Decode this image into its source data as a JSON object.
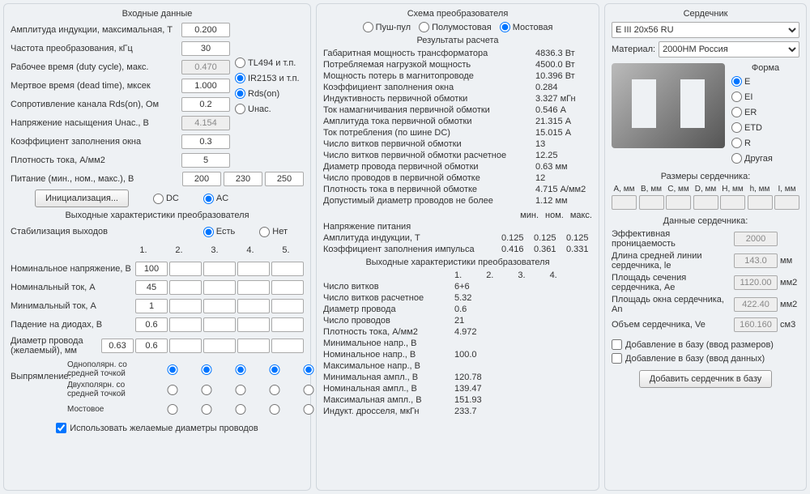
{
  "col1": {
    "title": "Входные данные",
    "inputs": [
      {
        "label": "Амплитуда индукции, максимальная, Т",
        "val": "0.200"
      },
      {
        "label": "Частота преобразования, кГц",
        "val": "30"
      },
      {
        "label": "Рабочее время (duty cycle), макс.",
        "val": "0.470",
        "dis": true
      },
      {
        "label": "Мертвое время (dead time), мксек",
        "val": "1.000"
      },
      {
        "label": "Сопротивление канала Rds(on), Ом",
        "val": "0.2"
      },
      {
        "label": "Напряжение насыщения Uнас., В",
        "val": "4.154",
        "dis": true
      },
      {
        "label": "Коэффициент заполнения окна",
        "val": "0.3"
      },
      {
        "label": "Плотность тока, А/мм2",
        "val": "5"
      }
    ],
    "side_radios": [
      "TL494 и т.п.",
      "IR2153 и т.п.",
      "Rds(on)",
      "Uнас."
    ],
    "side_sel": 1,
    "supply_label": "Питание (мин., ном., макс.), В",
    "supply": [
      "200",
      "230",
      "250"
    ],
    "init_btn": "Инициализация...",
    "dcac": [
      "DC",
      "AC"
    ],
    "dcac_sel": 1,
    "out_title": "Выходные характеристики преобразователя",
    "stab_label": "Стабилизация выходов",
    "stab": [
      "Есть",
      "Нет"
    ],
    "stab_sel": 0,
    "col_nums": [
      "1.",
      "2.",
      "3.",
      "4.",
      "5."
    ],
    "out_rows": [
      {
        "label": "Номинальное напряжение, В",
        "vals": [
          "100",
          "",
          "",
          "",
          ""
        ]
      },
      {
        "label": "Номинальный ток, А",
        "vals": [
          "45",
          "",
          "",
          "",
          ""
        ]
      },
      {
        "label": "Минимальный ток, А",
        "vals": [
          "1",
          "",
          "",
          "",
          ""
        ]
      },
      {
        "label": "Падение на диодах, В",
        "vals": [
          "0.6",
          "",
          "",
          "",
          ""
        ]
      }
    ],
    "wire_label": "Диаметр провода (желаемый), мм",
    "wire": [
      "0.63",
      "0.6",
      "",
      "",
      "",
      ""
    ],
    "rect_label": "Выпрямление:",
    "rect_opts": [
      "Однополярн. со средней точкой",
      "Двухполярн. со средней точкой",
      "Мостовое"
    ],
    "use_wire": "Использовать желаемые диаметры проводов"
  },
  "col2": {
    "title": "Схема преобразователя",
    "scheme": [
      "Пуш-пул",
      "Полумостовая",
      "Мостовая"
    ],
    "scheme_sel": 2,
    "res_title": "Результаты расчета",
    "results": [
      {
        "l": "Габаритная мощность трансформатора",
        "v": "4836.3 Вт"
      },
      {
        "l": "Потребляемая нагрузкой мощность",
        "v": "4500.0 Вт"
      },
      {
        "l": "Мощность потерь в магнитопроводе",
        "v": "10.396 Вт"
      },
      {
        "l": "Коэффициент заполнения окна",
        "v": "0.284"
      },
      {
        "l": "Индуктивность первичной обмотки",
        "v": "3.327 мГн"
      },
      {
        "l": "Ток намагничивания первичной обмотки",
        "v": "0.546 А"
      },
      {
        "l": "Амплитуда тока первичной обмотки",
        "v": "21.315 А"
      },
      {
        "l": "Ток потребления (по шине DC)",
        "v": "15.015 А"
      },
      {
        "l": "Число витков первичной обмотки",
        "v": "13"
      },
      {
        "l": "Число витков первичной обмотки расчетное",
        "v": "12.25"
      },
      {
        "l": "Диаметр провода первичной обмотки",
        "v": "0.63 мм"
      },
      {
        "l": "Число проводов в первичной обмотке",
        "v": "12"
      },
      {
        "l": "Плотность тока в первичной обмотке",
        "v": "4.715 А/мм2"
      },
      {
        "l": "Допустимый диаметр проводов не более",
        "v": "1.12 мм"
      }
    ],
    "mnm_hdr": [
      "мин.",
      "ном.",
      "макс."
    ],
    "mnm": [
      {
        "l": "Напряжение питания",
        "v": [
          "",
          "",
          ""
        ]
      },
      {
        "l": "Амплитуда индукции, Т",
        "v": [
          "0.125",
          "0.125",
          "0.125"
        ]
      },
      {
        "l": "Коэффициент заполнения импульса",
        "v": [
          "0.416",
          "0.361",
          "0.331"
        ]
      }
    ],
    "out2_title": "Выходные характеристики преобразователя",
    "out2_cols": [
      "1.",
      "2.",
      "3.",
      "4."
    ],
    "out2": [
      {
        "l": "Число витков",
        "v": "6+6"
      },
      {
        "l": "Число витков расчетное",
        "v": "5.32"
      },
      {
        "l": "Диаметр провода",
        "v": "0.6"
      },
      {
        "l": "Число проводов",
        "v": "21"
      },
      {
        "l": "Плотность тока, А/мм2",
        "v": "4.972"
      },
      {
        "l": "Минимальное напр., В",
        "v": ""
      },
      {
        "l": "Номинальное напр., В",
        "v": "100.0"
      },
      {
        "l": "Максимальное напр., В",
        "v": ""
      },
      {
        "l": "Минимальная ампл., В",
        "v": "120.78"
      },
      {
        "l": "Номинальная ампл., В",
        "v": "139.47"
      },
      {
        "l": "Максимальная ампл., В",
        "v": "151.93"
      },
      {
        "l": "Индукт. дросселя, мкГн",
        "v": "233.7"
      }
    ]
  },
  "col3": {
    "title": "Сердечник",
    "core_sel": "E III 20x56 RU",
    "mat_label": "Материал:",
    "mat_sel": "2000НМ Россия",
    "shape_title": "Форма",
    "shapes": [
      "E",
      "EI",
      "ER",
      "ETD",
      "R",
      "Другая"
    ],
    "shape_sel": 0,
    "size_title": "Размеры сердечника:",
    "size_hdr": [
      "A, мм",
      "B, мм",
      "C, мм",
      "D, мм",
      "H, мм",
      "h, мм",
      "I, мм"
    ],
    "data_title": "Данные сердечника:",
    "data": [
      {
        "l": "Эффективная проницаемость",
        "v": "2000",
        "u": ""
      },
      {
        "l": "Длина средней линии сердечника, le",
        "v": "143.0",
        "u": "мм"
      },
      {
        "l": "Площадь сечения сердечника, Ае",
        "v": "1120.00",
        "u": "мм2"
      },
      {
        "l": "Площадь окна сердечника, An",
        "v": "422.40",
        "u": "мм2"
      },
      {
        "l": "Объем сердечника, Ve",
        "v": "160.160",
        "u": "см3"
      }
    ],
    "add1": "Добавление в базу (ввод размеров)",
    "add2": "Добавление в базу (ввод данных)",
    "add_btn": "Добавить сердечник в базу"
  }
}
